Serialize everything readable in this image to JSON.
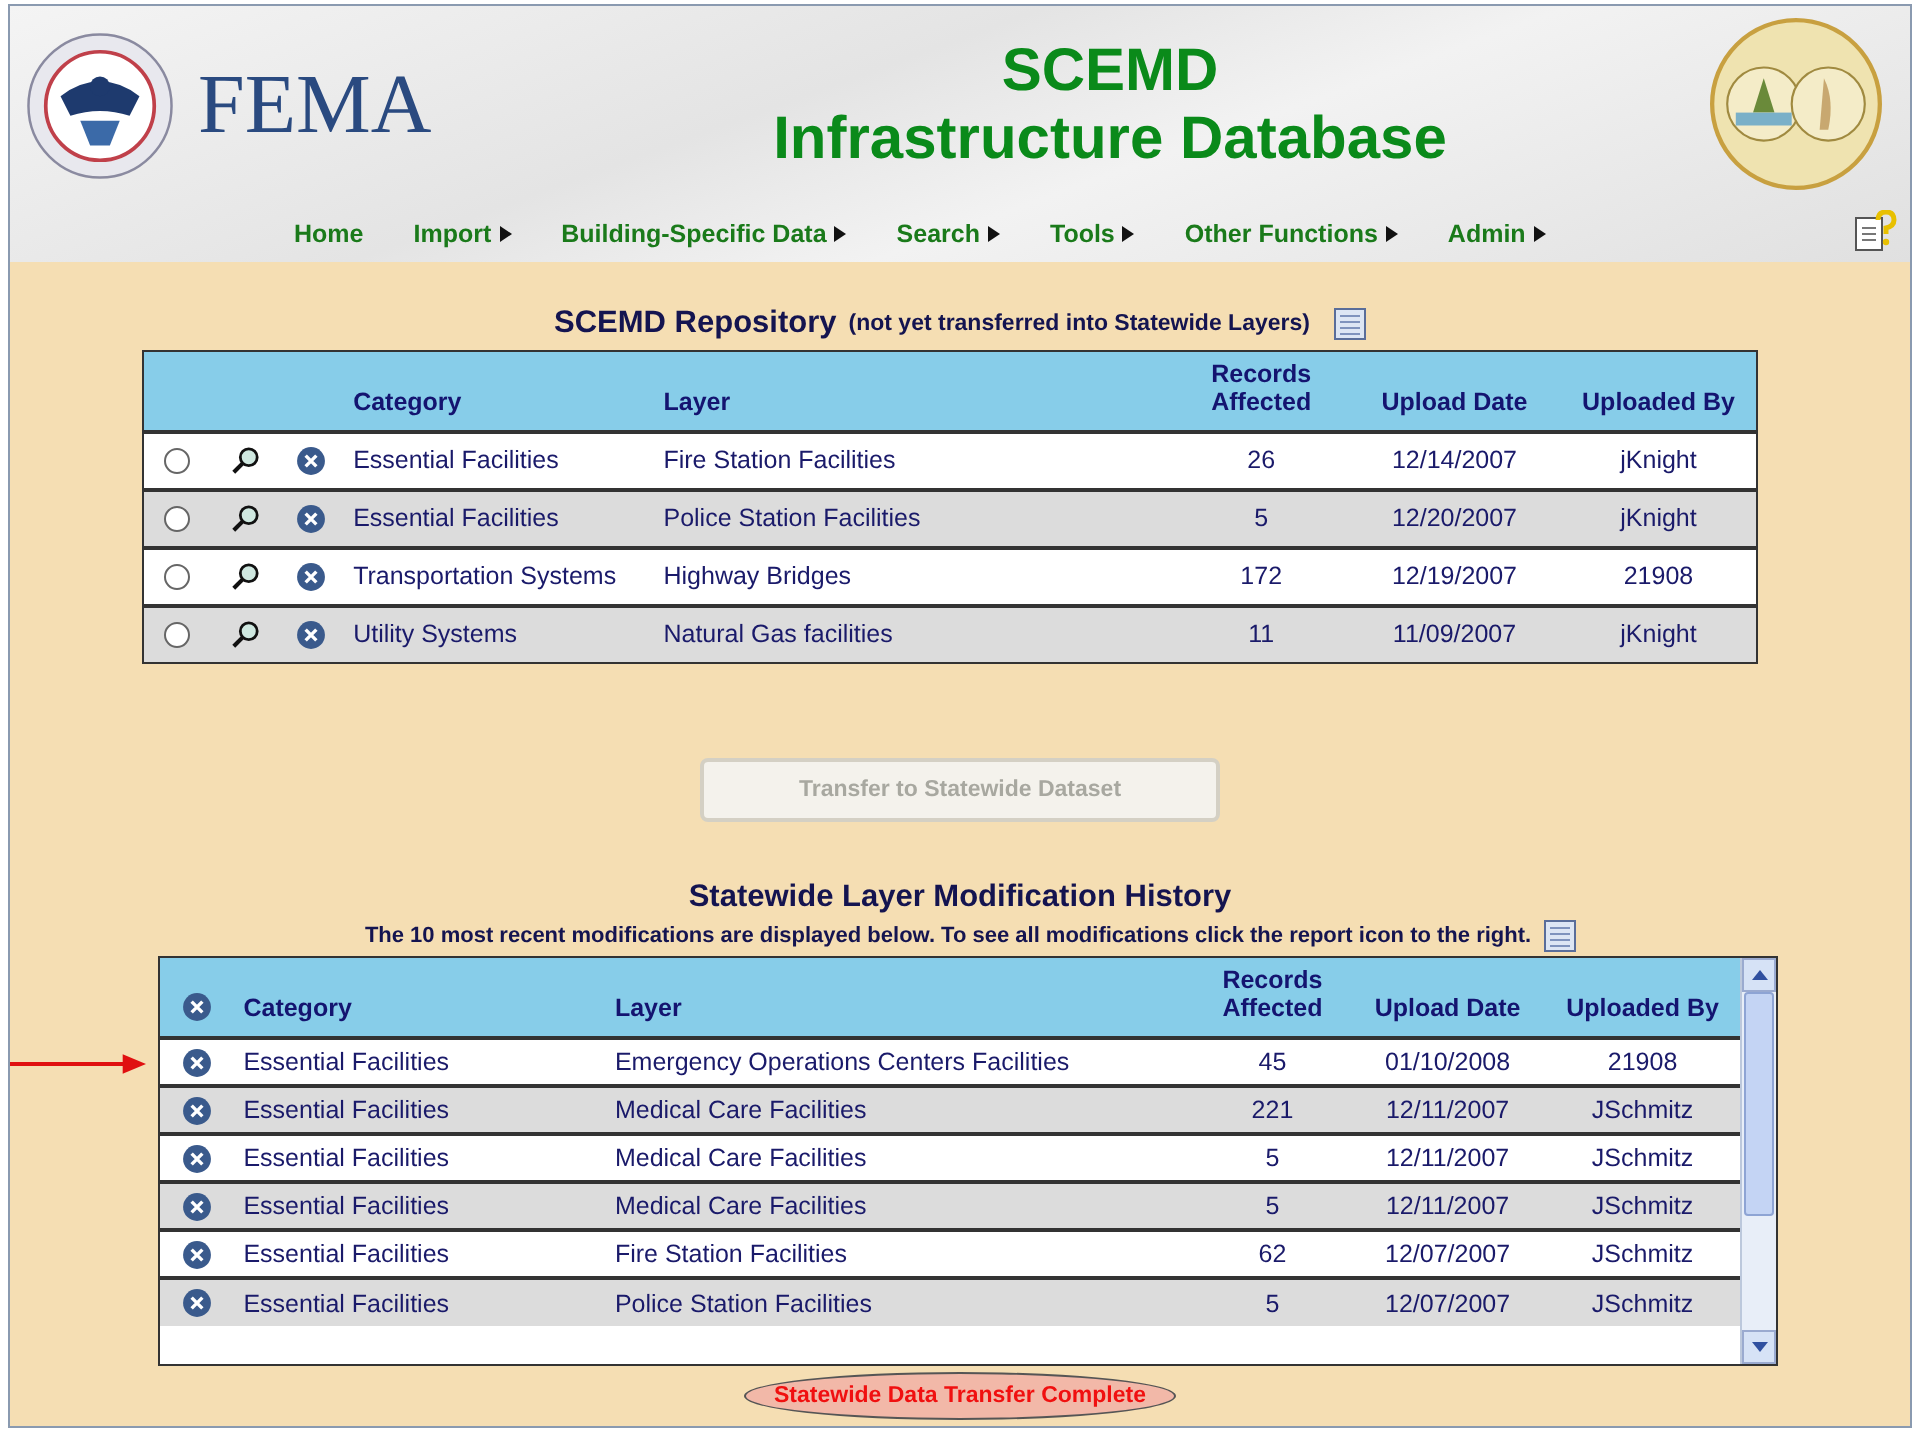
{
  "header": {
    "agency": "FEMA",
    "title": "SCEMD",
    "subtitle": "Infrastructure Database"
  },
  "nav": [
    {
      "label": "Home",
      "has_menu": false
    },
    {
      "label": "Import",
      "has_menu": true
    },
    {
      "label": "Building-Specific Data",
      "has_menu": true
    },
    {
      "label": "Search",
      "has_menu": true
    },
    {
      "label": "Tools",
      "has_menu": true
    },
    {
      "label": "Other Functions",
      "has_menu": true
    },
    {
      "label": "Admin",
      "has_menu": true
    }
  ],
  "repository": {
    "title": "SCEMD Repository",
    "subtitle": "(not yet transferred into Statewide Layers)",
    "columns": [
      "Category",
      "Layer",
      "Records Affected",
      "Upload Date",
      "Uploaded By"
    ],
    "rows": [
      {
        "selected": false,
        "category": "Essential Facilities",
        "layer": "Fire Station Facilities",
        "records": "26",
        "date": "12/14/2007",
        "by": "jKnight"
      },
      {
        "selected": false,
        "category": "Essential Facilities",
        "layer": "Police Station Facilities",
        "records": "5",
        "date": "12/20/2007",
        "by": "jKnight"
      },
      {
        "selected": false,
        "category": "Transportation Systems",
        "layer": "Highway Bridges",
        "records": "172",
        "date": "12/19/2007",
        "by": "21908"
      },
      {
        "selected": false,
        "category": "Utility Systems",
        "layer": "Natural Gas facilities",
        "records": "11",
        "date": "11/09/2007",
        "by": "jKnight"
      }
    ]
  },
  "transfer_button": {
    "label": "Transfer to Statewide Dataset",
    "disabled": true
  },
  "history": {
    "title": "Statewide Layer Modification History",
    "note": "The 10 most recent modifications are displayed below. To see all modifications click the report icon to the right.",
    "columns": [
      "Category",
      "Layer",
      "Records Affected",
      "Upload Date",
      "Uploaded By"
    ],
    "rows": [
      {
        "marked": true,
        "category": "Essential Facilities",
        "layer": "Emergency Operations Centers Facilities",
        "records": "45",
        "date": "01/10/2008",
        "by": "21908"
      },
      {
        "marked": false,
        "category": "Essential Facilities",
        "layer": "Medical Care Facilities",
        "records": "221",
        "date": "12/11/2007",
        "by": "JSchmitz"
      },
      {
        "marked": false,
        "category": "Essential Facilities",
        "layer": "Medical Care Facilities",
        "records": "5",
        "date": "12/11/2007",
        "by": "JSchmitz"
      },
      {
        "marked": false,
        "category": "Essential Facilities",
        "layer": "Medical Care Facilities",
        "records": "5",
        "date": "12/11/2007",
        "by": "JSchmitz"
      },
      {
        "marked": false,
        "category": "Essential Facilities",
        "layer": "Fire Station Facilities",
        "records": "62",
        "date": "12/07/2007",
        "by": "JSchmitz"
      },
      {
        "marked": false,
        "category": "Essential Facilities",
        "layer": "Police Station Facilities",
        "records": "5",
        "date": "12/07/2007",
        "by": "JSchmitz"
      }
    ]
  },
  "status_message": "Statewide Data Transfer Complete"
}
